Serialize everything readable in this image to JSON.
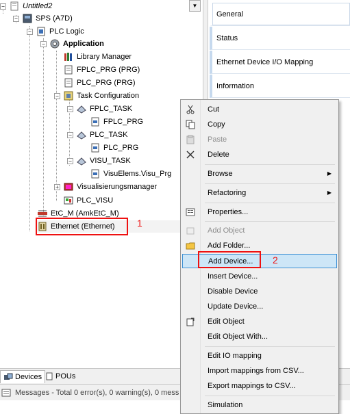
{
  "tree": {
    "items": [
      {
        "label": "Untitled2",
        "italic": true
      },
      {
        "label": "SPS (A7D)"
      },
      {
        "label": "PLC Logic"
      },
      {
        "label": "Application",
        "bold": true
      },
      {
        "label": "Library Manager"
      },
      {
        "label": "FPLC_PRG (PRG)"
      },
      {
        "label": "PLC_PRG (PRG)"
      },
      {
        "label": "Task Configuration"
      },
      {
        "label": "FPLC_TASK"
      },
      {
        "label": "FPLC_PRG"
      },
      {
        "label": "PLC_TASK"
      },
      {
        "label": "PLC_PRG"
      },
      {
        "label": "VISU_TASK"
      },
      {
        "label": "VisuElems.Visu_Prg"
      },
      {
        "label": "Visualisierungsmanager"
      },
      {
        "label": "PLC_VISU"
      },
      {
        "label": "EtC_M (AmkEtC_M)"
      },
      {
        "label": "Ethernet (Ethernet)"
      }
    ],
    "collapse_glyph": "−",
    "expand_glyph": "+"
  },
  "right_tabs": [
    {
      "label": "General"
    },
    {
      "label": "Status"
    },
    {
      "label": "Ethernet Device I/O Mapping"
    },
    {
      "label": "Information"
    }
  ],
  "bottom_tabs": [
    {
      "label": "Devices"
    },
    {
      "label": "POUs"
    }
  ],
  "status": {
    "text": "Messages - Total 0 error(s), 0 warning(s), 0 mess"
  },
  "context_menu": {
    "items": [
      {
        "label": "Cut"
      },
      {
        "label": "Copy"
      },
      {
        "label": "Paste"
      },
      {
        "label": "Delete"
      },
      {
        "label": "Browse"
      },
      {
        "label": "Refactoring"
      },
      {
        "label": "Properties..."
      },
      {
        "label": "Add Object"
      },
      {
        "label": "Add Folder..."
      },
      {
        "label": "Add Device..."
      },
      {
        "label": "Insert Device..."
      },
      {
        "label": "Disable Device"
      },
      {
        "label": "Update Device..."
      },
      {
        "label": "Edit Object"
      },
      {
        "label": "Edit Object With..."
      },
      {
        "label": "Edit IO mapping"
      },
      {
        "label": "Import mappings from CSV..."
      },
      {
        "label": "Export mappings to CSV..."
      },
      {
        "label": "Simulation"
      }
    ]
  },
  "annotations": {
    "step1": "1",
    "step2": "2"
  },
  "colors": {
    "highlight": "#cde6f7",
    "annotation": "#ee1111"
  }
}
